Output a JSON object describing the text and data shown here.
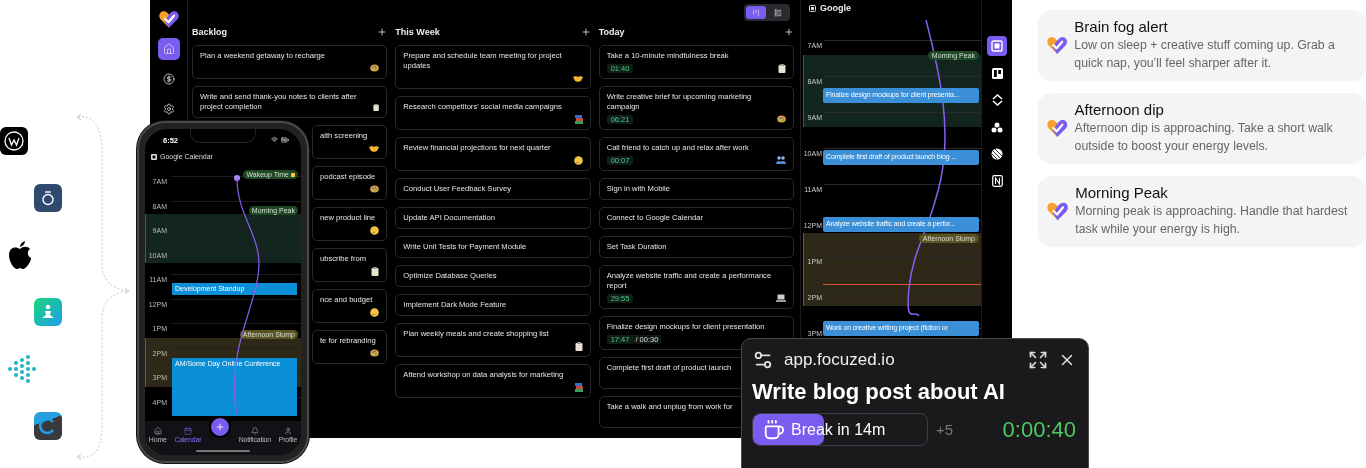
{
  "desktop": {
    "sidebar": [
      {
        "selected": true
      },
      {
        "selected": false
      },
      {
        "selected": false
      }
    ],
    "view_toggle": [
      {
        "selected": true
      },
      {
        "selected": false
      }
    ],
    "columns": [
      {
        "title": "Backlog",
        "cards": [
          {
            "text": "Plan a weekend getaway to recharge",
            "kind": "palette"
          },
          {
            "text": "Write and send thank-you notes to clients after project completion",
            "kind": "clipboard"
          },
          {
            "text": "alth screening",
            "kind": "handshake"
          },
          {
            "text": "podcast episode",
            "kind": "palette"
          },
          {
            "text": "new product line",
            "kind": "face"
          },
          {
            "text": "ubscribe from",
            "kind": "clipboard"
          },
          {
            "text": "nce and budget",
            "kind": "face"
          },
          {
            "text": "te for rebranding",
            "kind": "palette"
          }
        ]
      },
      {
        "title": "This Week",
        "cards": [
          {
            "text": "Prepare and schedule team meeting for project updates",
            "kind": "handshake"
          },
          {
            "text": "Research competitors' social media campaigns",
            "kind": "books"
          },
          {
            "text": "Review financial projections for next quarter",
            "kind": "face"
          },
          {
            "text": "Conduct User Feedback Survey",
            "kind": "plain"
          },
          {
            "text": "Update API Documentation",
            "kind": "plain"
          },
          {
            "text": "Write Unit Tests for Payment Module",
            "kind": "plain"
          },
          {
            "text": "Optimize Database Queries",
            "kind": "plain"
          },
          {
            "text": "Implement Dark Mode Feature",
            "kind": "plain"
          },
          {
            "text": "Plan weekly meals and create shopping list",
            "kind": "clipboard"
          },
          {
            "text": "Attend workshop on data analysis for marketing",
            "kind": "books"
          }
        ]
      },
      {
        "title": "Today",
        "cards": [
          {
            "text": "Take a 10-minute mindfulness break",
            "kind": "clipboard",
            "timer": "01:40"
          },
          {
            "text": "Write creative brief for upcoming marketing campaign",
            "kind": "palette",
            "timer": "06:21"
          },
          {
            "text": "Call friend to catch up and relax after work",
            "kind": "people",
            "timer": "00:07"
          },
          {
            "text": "Sign in with Mobile",
            "kind": "plain"
          },
          {
            "text": "Connect to Google Calendar",
            "kind": "plain"
          },
          {
            "text": "Set Task Duration",
            "kind": "plain"
          },
          {
            "text": "Analyze website traffic and create a performance report",
            "kind": "laptop",
            "timer": "29:55"
          },
          {
            "text": "Finalize design mockups for client presentation",
            "kind": "plain",
            "timer": "17:47",
            "limit": "/ 00:30"
          },
          {
            "text": "Complete first draft of product launch",
            "kind": "tall"
          },
          {
            "text": "Take a walk and unplug from work for",
            "kind": "tall"
          }
        ]
      }
    ],
    "calendar": {
      "title": "Google",
      "hours": [
        "7AM",
        "8AM",
        "9AM",
        "10AM",
        "11AM",
        "12PM",
        "1PM",
        "2PM",
        "3PM"
      ],
      "zones": [
        {
          "label": "Morning Peak",
          "kind": "peak"
        },
        {
          "label": "Afternoon Slump",
          "kind": "slump"
        }
      ],
      "events": [
        {
          "title": "Finalize design mockups for client presenta..."
        },
        {
          "title": "Complete first draft of product launch blog ..."
        },
        {
          "title": "Analyze website traffic and create a perfor..."
        },
        {
          "title": "Work on creative writing project (fiction or"
        }
      ]
    },
    "rail": [
      {
        "selected": true
      },
      {
        "selected": false
      },
      {
        "selected": false
      },
      {
        "selected": false
      },
      {
        "selected": false
      },
      {
        "selected": false
      }
    ]
  },
  "phone": {
    "time": "6:52",
    "calendar_title": "Google Calendar",
    "hours": [
      "7AM",
      "8AM",
      "9AM",
      "10AM",
      "11AM",
      "12PM",
      "1PM",
      "2PM",
      "3PM",
      "4PM"
    ],
    "badges": [
      {
        "label": "Wakeup Time",
        "kind": "wake"
      },
      {
        "label": "Morning Peak",
        "kind": "peak"
      },
      {
        "label": "Afternoon Slump",
        "kind": "slump"
      }
    ],
    "events": [
      {
        "title": "Development Standup"
      },
      {
        "title": "AM/Some Day Online Conference"
      }
    ],
    "nav": [
      {
        "label": "Home",
        "kind": "home",
        "selected": false
      },
      {
        "label": "Calendar",
        "kind": "calendar",
        "selected": true
      },
      {
        "kind": "add",
        "selected": false
      },
      {
        "label": "Notification",
        "kind": "bell",
        "selected": false
      },
      {
        "label": "Profile",
        "kind": "user",
        "selected": false
      }
    ]
  },
  "popup": {
    "host": "app.focuzed.io",
    "task": "Write blog post about AI",
    "break": {
      "label": "Break in 14m",
      "level": 0.41
    },
    "more": "+5",
    "timer": "0:00:40"
  },
  "notifications": [
    {
      "title": "Brain fog alert",
      "body": "Low on sleep + creative stuff coming up. Grab a quick nap, you’ll feel sharper after it."
    },
    {
      "title": "Afternoon dip",
      "body": "Afternoon dip is approaching. Take a short walk outside to boost your energy levels."
    },
    {
      "title": "Morning Peak",
      "body": "Morning peak is approaching. Handle that hardest task while your energy is high."
    }
  ]
}
